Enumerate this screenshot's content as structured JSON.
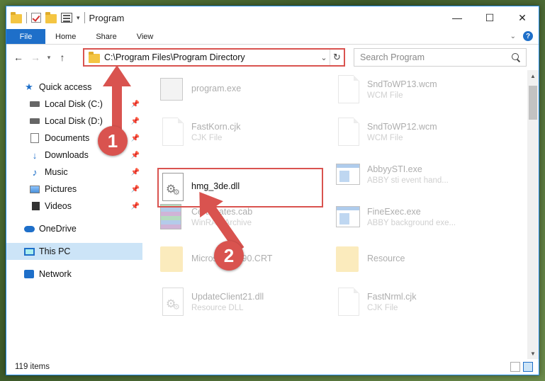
{
  "window": {
    "title": "Program",
    "controls": {
      "minimize": "—",
      "maximize": "☐",
      "close": "✕"
    }
  },
  "ribbon": {
    "file_tab": "File",
    "tabs": [
      "Home",
      "Share",
      "View"
    ],
    "help": "?"
  },
  "nav": {
    "address": "C:\\Program Files\\Program Directory",
    "search_placeholder": "Search Program"
  },
  "sidebar": {
    "quick_access": "Quick access",
    "items": [
      {
        "label": "Local Disk (C:)",
        "icon": "drive-icon"
      },
      {
        "label": "Local Disk (D:)",
        "icon": "drive-icon"
      },
      {
        "label": "Documents",
        "icon": "documents-icon"
      },
      {
        "label": "Downloads",
        "icon": "downloads-icon"
      },
      {
        "label": "Music",
        "icon": "music-icon"
      },
      {
        "label": "Pictures",
        "icon": "pictures-icon"
      },
      {
        "label": "Videos",
        "icon": "videos-icon"
      }
    ],
    "onedrive": "OneDrive",
    "this_pc": "This PC",
    "network": "Network"
  },
  "files": [
    {
      "name": "program.exe",
      "type": "",
      "thumb": "exe2"
    },
    {
      "name": "SndToWP13.wcm",
      "type": "WCM File",
      "thumb": "page"
    },
    {
      "name": "FastKorn.cjk",
      "type": "CJK File",
      "thumb": "page"
    },
    {
      "name": "SndToWP12.wcm",
      "type": "WCM File",
      "thumb": "page"
    },
    {
      "name": "hmg_3de.dll",
      "type": "",
      "thumb": "gear"
    },
    {
      "name": "AbbyySTI.exe",
      "type": "ABBY sti event hand...",
      "thumb": "exe"
    },
    {
      "name": "Certificates.cab",
      "type": "WinRAR Archive",
      "thumb": "rar"
    },
    {
      "name": "FineExec.exe",
      "type": "ABBY background exe...",
      "thumb": "exe"
    },
    {
      "name": "Microsoft.VC90.CRT",
      "type": "",
      "thumb": "folder"
    },
    {
      "name": "Resource",
      "type": "",
      "thumb": "folder"
    },
    {
      "name": "UpdateClient21.dll",
      "type": "Resource DLL",
      "thumb": "gear"
    },
    {
      "name": "FastNrml.cjk",
      "type": "CJK File",
      "thumb": "page"
    }
  ],
  "status": {
    "item_count": "119 items"
  },
  "annotations": {
    "step1": "1",
    "step2": "2",
    "accent": "#d9534f"
  }
}
